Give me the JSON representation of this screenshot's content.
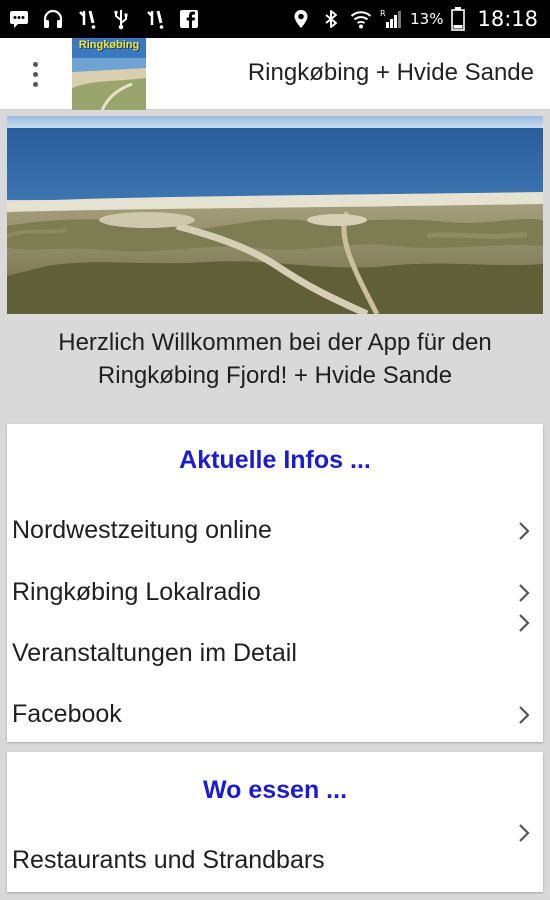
{
  "status_bar": {
    "battery_percent": "13%",
    "time": "18:18",
    "left_icons": [
      "message-icon",
      "headset-icon",
      "notification-icon",
      "usb-icon",
      "notification-icon",
      "facebook-icon"
    ],
    "right_icons": [
      "location-icon",
      "bluetooth-icon",
      "wifi-icon",
      "signal-icon",
      "battery-icon"
    ]
  },
  "app_bar": {
    "logo_text": "Ringkøbing",
    "title": "Ringkøbing + Hvide Sande"
  },
  "welcome": {
    "line1": "Herzlich Willkommen bei der App für den",
    "line2": "Ringkøbing Fjord! + Hvide Sande"
  },
  "sections": [
    {
      "heading": "Aktuelle Infos ...",
      "items": [
        {
          "label": "Nordwestzeitung online"
        },
        {
          "label": "Ringkøbing Lokalradio"
        },
        {
          "label": "Veranstaltungen im Detail"
        },
        {
          "label": "Facebook"
        }
      ]
    },
    {
      "heading": "Wo essen ...",
      "items": [
        {
          "label": "Restaurants und Strandbars"
        }
      ]
    }
  ],
  "colors": {
    "heading": "#1b1bcf",
    "statusbar": "#000000",
    "background": "#d9d9d9"
  }
}
